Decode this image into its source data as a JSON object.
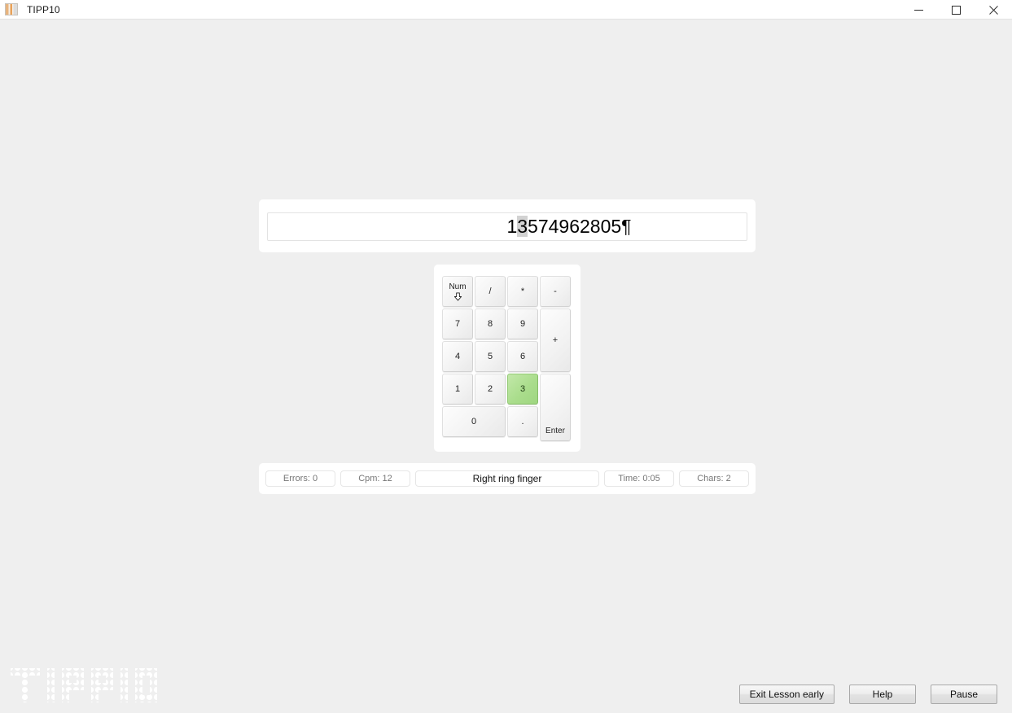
{
  "window": {
    "title": "TIPP10",
    "icon": "app-document-icon",
    "controls": {
      "minimize": "minimize-icon",
      "maximize": "maximize-icon",
      "close": "close-icon"
    }
  },
  "lesson": {
    "typed": "1",
    "current_char": "3",
    "pending": "574962805",
    "paragraph_mark": "¶",
    "full_text": "13574962805¶",
    "cursor_highlight_color": "#d2d2d2"
  },
  "keypad": {
    "active_key": "3",
    "active_color": "#aadd8c",
    "keys": [
      {
        "label": "Num",
        "name": "numlock-key",
        "sublabel": "down-arrow-icon"
      },
      {
        "label": "/",
        "name": "divide-key"
      },
      {
        "label": "*",
        "name": "multiply-key"
      },
      {
        "label": "-",
        "name": "minus-key"
      },
      {
        "label": "7",
        "name": "numpad-7-key"
      },
      {
        "label": "8",
        "name": "numpad-8-key"
      },
      {
        "label": "9",
        "name": "numpad-9-key"
      },
      {
        "label": "+",
        "name": "plus-key"
      },
      {
        "label": "4",
        "name": "numpad-4-key"
      },
      {
        "label": "5",
        "name": "numpad-5-key"
      },
      {
        "label": "6",
        "name": "numpad-6-key"
      },
      {
        "label": "1",
        "name": "numpad-1-key"
      },
      {
        "label": "2",
        "name": "numpad-2-key"
      },
      {
        "label": "3",
        "name": "numpad-3-key"
      },
      {
        "label": "Enter",
        "name": "enter-key"
      },
      {
        "label": "0",
        "name": "numpad-0-key"
      },
      {
        "label": ".",
        "name": "decimal-key"
      }
    ]
  },
  "status": {
    "errors": "Errors: 0",
    "cpm": "Cpm: 12",
    "finger": "Right ring finger",
    "time": "Time: 0:05",
    "chars": "Chars: 2"
  },
  "watermark": {
    "text": "TIPP10"
  },
  "buttons": {
    "exit_lesson": "Exit Lesson early",
    "help": "Help",
    "pause": "Pause"
  }
}
